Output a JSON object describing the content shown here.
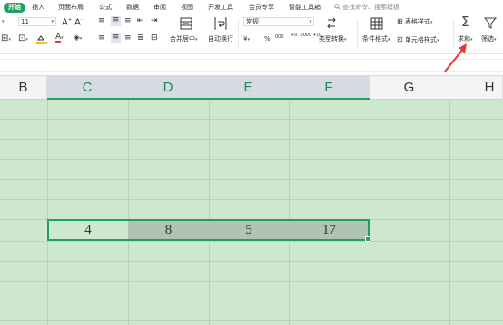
{
  "menu": {
    "tabs": [
      "开始",
      "插入",
      "页面布局",
      "公式",
      "数据",
      "审阅",
      "视图",
      "开发工具",
      "会员专享",
      "智能工具箱"
    ],
    "search_placeholder": "查找命令、搜索模板"
  },
  "ribbon": {
    "font_size": "11",
    "number_format": "常规",
    "merge_center": "合并居中",
    "auto_wrap": "自动换行",
    "currency_symbol": "¥",
    "percent_symbol": "%",
    "thousands_symbol": "000",
    "inc_decimal": "+0 .00",
    "dec_decimal": ".00 +0",
    "type_convert": "类型转换",
    "conditional_format": "条件格式",
    "table_style": "表格样式",
    "cell_style": "单元格样式",
    "sum": "求和",
    "filter": "筛选"
  },
  "sheet": {
    "column_headers": [
      "B",
      "C",
      "D",
      "E",
      "F",
      "G",
      "H"
    ],
    "selected_row_values": [
      "4",
      "8",
      "5",
      "17"
    ]
  },
  "colors": {
    "accent": "#1fa15f",
    "grid_background": "#cde8cf",
    "annotation_arrow": "#e53935"
  }
}
